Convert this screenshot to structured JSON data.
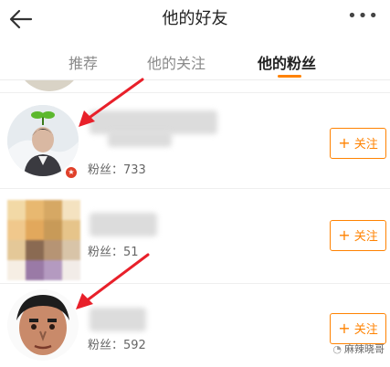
{
  "header": {
    "title": "他的好友",
    "back_icon": "arrow-left-icon",
    "more_label": "•••"
  },
  "tabs": [
    {
      "label": "推荐",
      "active": false
    },
    {
      "label": "他的关注",
      "active": false
    },
    {
      "label": "他的粉丝",
      "active": true
    }
  ],
  "colors": {
    "accent": "#ff8200",
    "arrow": "#e8202a"
  },
  "fans_list": [
    {
      "fans_text": "粉丝：733",
      "follow_label": "关注",
      "has_badge": true
    },
    {
      "fans_text": "粉丝：51",
      "follow_label": "关注",
      "has_badge": false
    },
    {
      "fans_text": "粉丝：592",
      "follow_label": "关注",
      "has_badge": false
    }
  ],
  "watermark": "麻辣晓哥"
}
